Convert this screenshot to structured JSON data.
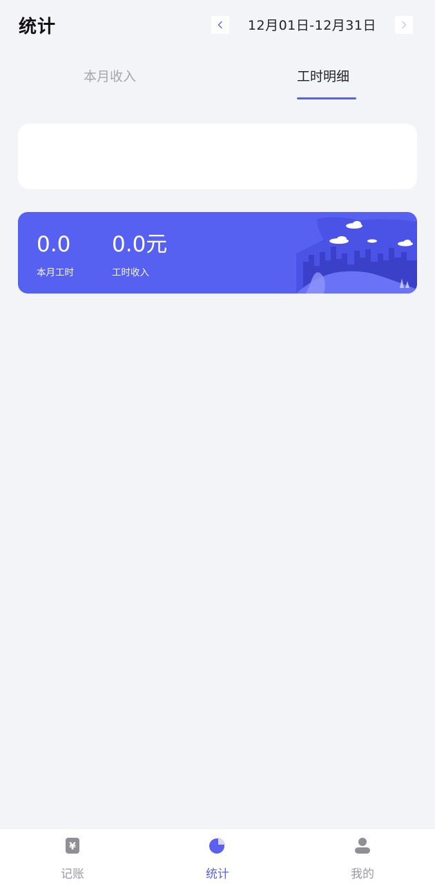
{
  "header": {
    "title": "统计",
    "date_range": "12月01日-12月31日",
    "prev_icon": "chevron-left-icon",
    "next_icon": "chevron-right-icon"
  },
  "tabs": [
    {
      "label": "本月收入",
      "active": false
    },
    {
      "label": "工时明细",
      "active": true
    }
  ],
  "summary": {
    "hours_value": "0.0",
    "hours_label": "本月工时",
    "income_value": "0.0元",
    "income_label": "工时收入"
  },
  "tabbar": {
    "items": [
      {
        "label": "记账",
        "icon": "ledger-yen-icon",
        "active": false
      },
      {
        "label": "统计",
        "icon": "pie-chart-icon",
        "active": true
      },
      {
        "label": "我的",
        "icon": "user-icon",
        "active": false
      }
    ]
  },
  "colors": {
    "accent": "#5b5ff2",
    "card": "#5761f1",
    "background": "#f3f4f7",
    "inactive": "#9a9aa2"
  }
}
